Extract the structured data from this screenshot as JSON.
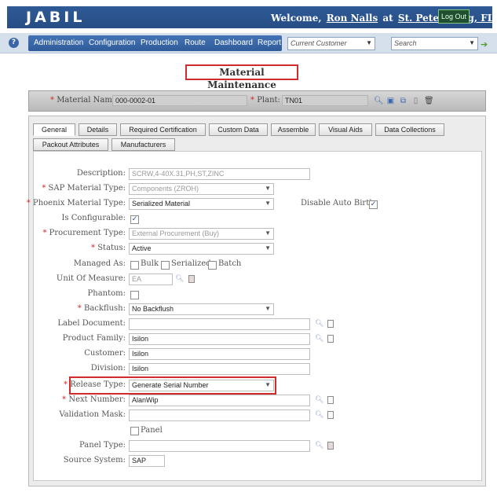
{
  "header": {
    "logo": "JABIL",
    "welcome_prefix": "Welcome,",
    "user": "Ron Nalls",
    "at": "at",
    "site": "St. Petersburg, FL",
    "logout": "Log Out"
  },
  "nav": {
    "menu": [
      "Administration",
      "Configuration",
      "Production",
      "Route",
      "Dashboard",
      "Report"
    ],
    "customer_placeholder": "Current Customer",
    "search_placeholder": "Search"
  },
  "page_title": "Material Maintenance",
  "material_bar": {
    "material_name_label": "Material Name:",
    "material_name": "000-0002-01",
    "plant_label": "Plant:",
    "plant": "TN01"
  },
  "tabs_row1": [
    "General",
    "Details",
    "Required Certification",
    "Custom Data",
    "Assemble",
    "Visual Aids",
    "Data Collections"
  ],
  "tabs_row2": [
    "Packout Attributes",
    "Manufacturers"
  ],
  "form": {
    "description_label": "Description:",
    "description": "SCRW,4-40X.31,PH,ST,ZINC",
    "sap_type_label": "SAP Material Type:",
    "sap_type": "Components (ZROH)",
    "phoenix_type_label": "Phoenix Material Type:",
    "phoenix_type": "Serialized Material",
    "disable_auto_birth_label": "Disable Auto Birth:",
    "is_configurable_label": "Is Configurable:",
    "procurement_label": "Procurement Type:",
    "procurement": "External Procurement (Buy)",
    "status_label": "Status:",
    "status": "Active",
    "managed_as_label": "Managed As:",
    "managed_bulk": "Bulk",
    "managed_serialized": "Serialized",
    "managed_batch": "Batch",
    "uom_label": "Unit Of Measure:",
    "uom": "EA",
    "phantom_label": "Phantom:",
    "backflush_label": "Backflush:",
    "backflush": "No Backflush",
    "label_document_label": "Label Document:",
    "label_document": "",
    "product_family_label": "Product Family:",
    "product_family": "Isilon",
    "customer_label": "Customer:",
    "customer": "Isilon",
    "division_label": "Division:",
    "division": "Isilon",
    "release_type_label": "Release Type:",
    "release_type": "Generate Serial Number",
    "next_number_label": "Next Number:",
    "next_number": "AlanWip",
    "validation_mask_label": "Validation Mask:",
    "validation_mask": "",
    "panel_label": "Panel",
    "panel_type_label": "Panel Type:",
    "panel_type": "",
    "source_system_label": "Source System:",
    "source_system": "SAP"
  }
}
